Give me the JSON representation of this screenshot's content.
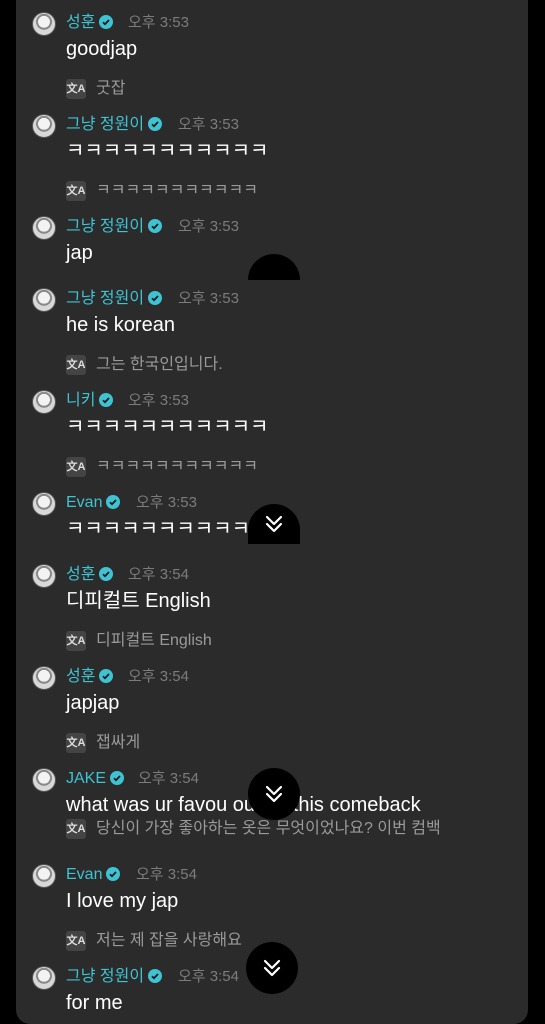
{
  "messages": [
    {
      "name": "성훈",
      "time": "오후 3:53",
      "text": "goodjap",
      "translation": "굿잡"
    },
    {
      "name": "그냥 정원이",
      "time": "오후 3:53",
      "text": "ㅋㅋㅋㅋㅋㅋㅋㅋㅋㅋㅋ",
      "translation": "ㅋㅋㅋㅋㅋㅋㅋㅋㅋㅋㅋ"
    },
    {
      "name": "그냥 정원이",
      "time": "오후 3:53",
      "text": "jap",
      "translation": ""
    },
    {
      "name": "그냥 정원이",
      "time": "오후 3:53",
      "text": "he is korean",
      "translation": "그는 한국인입니다."
    },
    {
      "name": "니키",
      "time": "오후 3:53",
      "text": "ㅋㅋㅋㅋㅋㅋㅋㅋㅋㅋㅋ",
      "translation": "ㅋㅋㅋㅋㅋㅋㅋㅋㅋㅋㅋ"
    },
    {
      "name": "Evan",
      "time": "오후 3:53",
      "text": "ㅋㅋㅋㅋㅋㅋㅋㅋㅋㅋ",
      "translation": ""
    },
    {
      "name": "성훈",
      "time": "오후 3:54",
      "text": "디피컬트 English",
      "translation": "디피컬트 English"
    },
    {
      "name": "성훈",
      "time": "오후 3:54",
      "text": "japjap",
      "translation": "잽싸게"
    },
    {
      "name": "JAKE",
      "time": "오후 3:54",
      "text": "what was ur favou outfit? this comeback",
      "translation": "당신이 가장 좋아하는 옷은 무엇이었나요? 이번 컴백"
    },
    {
      "name": "Evan",
      "time": "오후 3:54",
      "text": "I love my jap",
      "translation": "저는 제 잡을 사랑해요"
    },
    {
      "name": "그냥 정원이",
      "time": "오후 3:54",
      "text": "for me",
      "translation": ""
    }
  ],
  "icons": {
    "translate": "文A",
    "scroll": "chevron-double-down-icon",
    "verified": "verified-badge-icon"
  },
  "colors": {
    "name": "#3fc3d3",
    "background": "#2b2b2b",
    "verified": "#3fc3d3"
  }
}
